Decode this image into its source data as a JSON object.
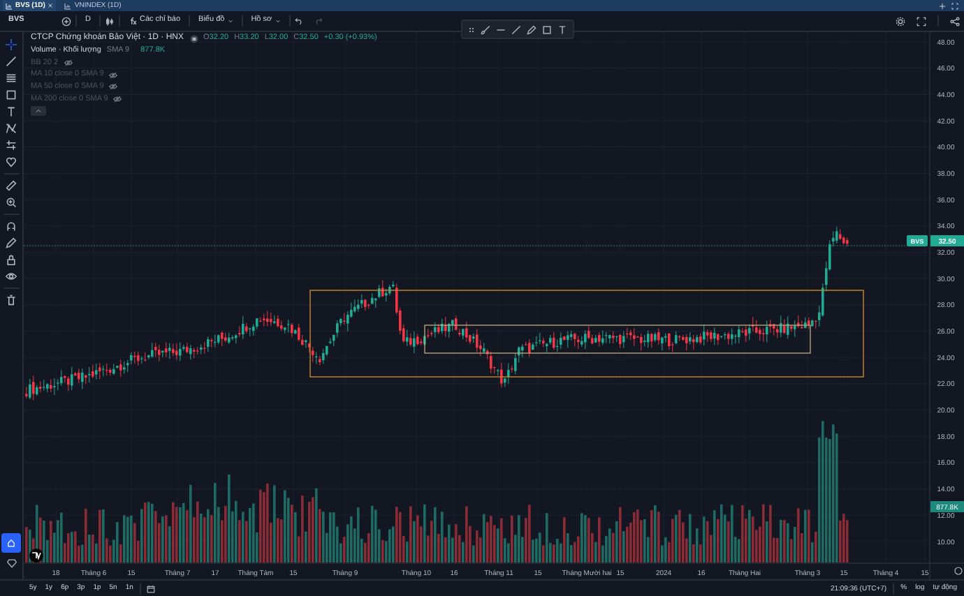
{
  "tabs": [
    {
      "label": "BVS (1D)",
      "selected": true,
      "closable": true
    },
    {
      "label": "VNINDEX (1D)",
      "selected": false,
      "closable": false
    }
  ],
  "toolbar": {
    "symbol": "BVS",
    "interval": "D",
    "indicators": "Các chỉ báo",
    "menus": [
      "Biểu đồ",
      "Hồ sơ"
    ]
  },
  "legend": {
    "title": "CTCP Chứng khoán Bảo Việt · 1D · HNX",
    "ohlc": [
      {
        "label": "O",
        "value": "32.20"
      },
      {
        "label": "H",
        "value": "33.20"
      },
      {
        "label": "L",
        "value": "32.00"
      },
      {
        "label": "C",
        "value": "32.50"
      }
    ],
    "change": "+0.30 (+0.93%)",
    "volume": {
      "name": "Volume · Khối lượng",
      "params": "SMA 9",
      "value": "877.8K"
    },
    "studies": [
      {
        "label": "BB 20 2",
        "hidden": true
      },
      {
        "label": "MA 10 close 0 SMA 9",
        "hidden": true
      },
      {
        "label": "MA 50 close 0 SMA 9",
        "hidden": true
      },
      {
        "label": "MA 200 close 0 SMA 9",
        "hidden": true
      }
    ]
  },
  "price_axis": {
    "ticks": [
      "48.00",
      "46.00",
      "44.00",
      "42.00",
      "40.00",
      "38.00",
      "36.00",
      "34.00",
      "32.00",
      "30.00",
      "28.00",
      "26.00",
      "24.00",
      "22.00",
      "20.00",
      "18.00",
      "16.00",
      "14.00",
      "12.00",
      "10.00"
    ],
    "price_tag": {
      "symbol": "BVS",
      "value": "32.50"
    },
    "volume_tag": "877.8K"
  },
  "time_axis": [
    "18",
    "Tháng 6",
    "15",
    "Tháng 7",
    "17",
    "Tháng Tám",
    "15",
    "Tháng 9",
    "Tháng 10",
    "16",
    "Tháng 11",
    "15",
    "Tháng Mười hai",
    "15",
    "2024",
    "16",
    "Tháng Hai",
    "Tháng 3",
    "15",
    "Tháng 4",
    "15"
  ],
  "bottom_bar": {
    "ranges": [
      "5y",
      "1y",
      "6p",
      "3p",
      "1p",
      "5n",
      "1n"
    ],
    "time": "21:09:36 (UTC+7)",
    "options": [
      "%",
      "log",
      "tự động"
    ]
  }
}
